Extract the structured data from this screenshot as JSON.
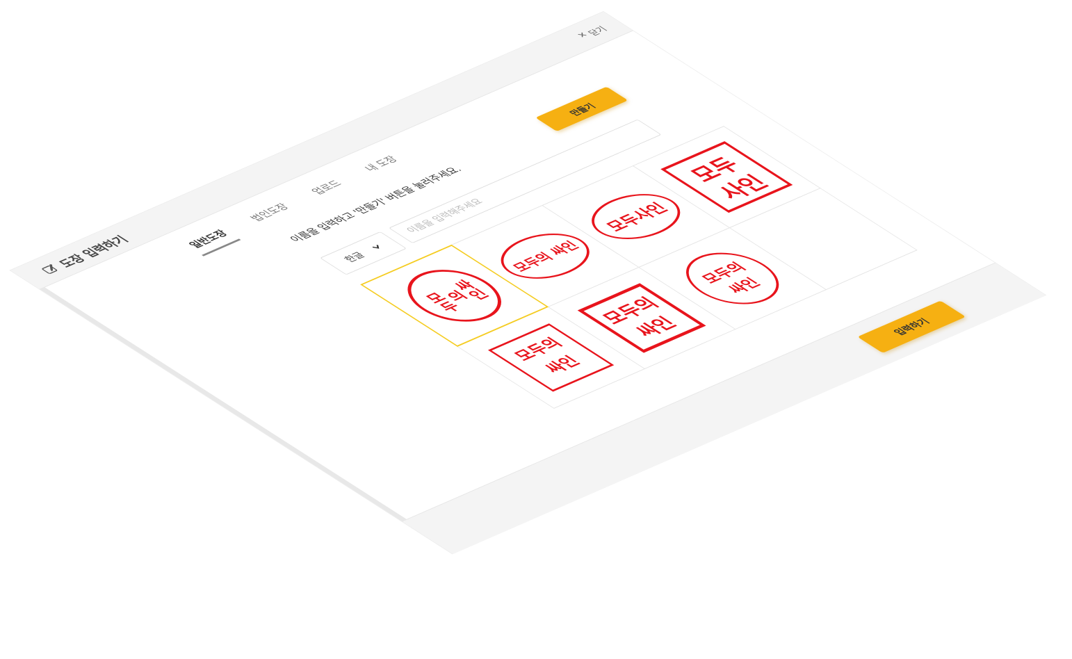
{
  "header": {
    "title": "도장 입력하기",
    "title_icon": "stamp-pencil-icon",
    "close_label": "닫기",
    "close_icon": "close-x-icon"
  },
  "tabs": [
    {
      "label": "일반도장",
      "active": true
    },
    {
      "label": "법인도장",
      "active": false
    },
    {
      "label": "업로드",
      "active": false
    },
    {
      "label": "내 도장",
      "active": false
    }
  ],
  "instruction": "이름을 입력하고 '만들기' 버튼을 눌러주세요.",
  "make_button": "만들기",
  "lang_select": {
    "value": "한글",
    "icon": "chevron-down-icon"
  },
  "name_input": {
    "value": "",
    "placeholder": "이름을 입력해주세요"
  },
  "stamps": [
    {
      "label": "모두의 싸인",
      "selected": true
    },
    {
      "label": "모두의 싸인",
      "selected": false
    },
    {
      "label": "모두사인",
      "selected": false
    },
    {
      "label": "모두 사인",
      "selected": false
    },
    {
      "label": "모두의 싸인",
      "selected": false
    },
    {
      "label": "모두의 싸인",
      "selected": false
    },
    {
      "label": "모두의 싸인",
      "selected": false
    },
    {
      "label": "",
      "selected": false
    }
  ],
  "submit_button": "입력하기",
  "colors": {
    "accent": "#f6b012",
    "seal_red": "#e8141c",
    "selected_border": "#f5cc20"
  }
}
